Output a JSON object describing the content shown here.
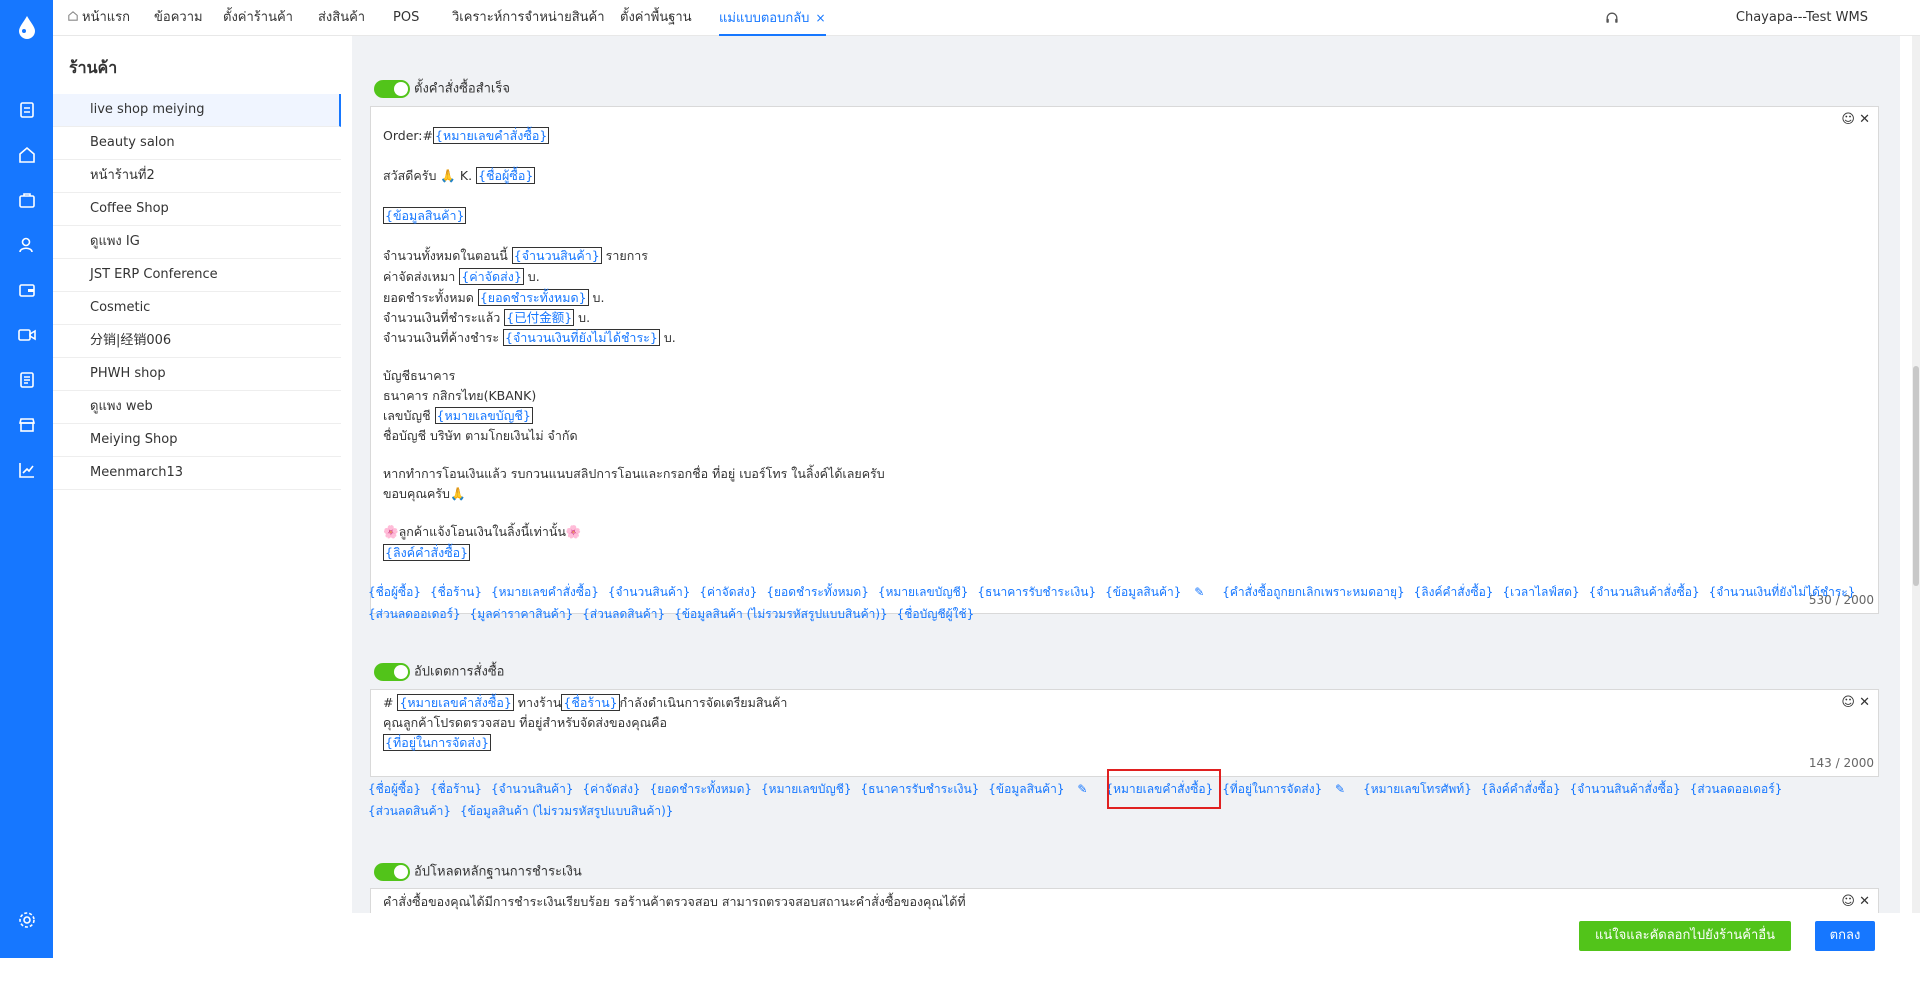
{
  "rail": {
    "icons": [
      "logo-icon",
      "document-icon",
      "home-icon",
      "bag-icon",
      "users-icon",
      "wallet-icon",
      "video-icon",
      "list-icon",
      "shop-icon",
      "chart-icon",
      "settings-icon"
    ]
  },
  "tabs": [
    {
      "label": "หน้าแรก"
    },
    {
      "label": "ข้อความ"
    },
    {
      "label": "ตั้งค่าร้านค้า"
    },
    {
      "label": "ส่งสินค้า"
    },
    {
      "label": "POS"
    },
    {
      "label": "วิเคราะห์การจำหน่ายสินค้า"
    },
    {
      "label": "ตั้งค่าพื้นฐาน"
    },
    {
      "label": "แม่แบบตอบกลับ",
      "close": "×"
    }
  ],
  "user": {
    "name": "Chayapa---Test WMS"
  },
  "store": {
    "title": "ร้านค้า",
    "items": [
      "live shop meiying",
      "Beauty salon",
      "หน้าร้านที่2",
      "Coffee Shop",
      "ดูแพง IG",
      "JST ERP Conference",
      "Cosmetic",
      "分销|经销006",
      "PHWH shop",
      "ดูแพง web",
      "Meiying Shop",
      "Meenmarch13"
    ]
  },
  "sections": {
    "s1": {
      "title": "ตั้งคำสั่งซื้อสำเร็จ",
      "counter": "530 / 2000",
      "lines": {
        "l1a": "Order:#",
        "l1t": "{หมายเลขคำสั่งซื้อ}",
        "l2a": "สวัสดีครับ 🙏 K.",
        "l2t": "{ชื่อผู้ซื้อ}",
        "l3t": "{ข้อมูลสินค้า}",
        "l4a": "จำนวนทั้งหมดในตอนนี้",
        "l4t": "{จำนวนสินค้า}",
        "l4b": "รายการ",
        "l5a": "ค่าจัดส่งเหมา",
        "l5t": "{ค่าจัดส่ง}",
        "l5b": "บ.",
        "l6a": "ยอดชำระทั้งหมด",
        "l6t": "{ยอดชำระทั้งหมด}",
        "l6b": "บ.",
        "l7a": "จำนวนเงินที่ชำระแล้ว",
        "l7t": "{已付金额}",
        "l7b": "บ.",
        "l8a": "จำนวนเงินที่ค้างชำระ",
        "l8t": "{จำนวนเงินที่ยังไม่ได้ชำระ}",
        "l8b": "บ.",
        "l9": "บัญชีธนาคาร",
        "l10": "ธนาคาร กสิกรไทย(KBANK)",
        "l11a": "เลขบัญชี",
        "l11t": "{หมายเลขบัญชี}",
        "l12": "ชื่อบัญชี บริษัท ตามโกยเงินไม่ จำกัด",
        "l13": "หากทำการโอนเงินแล้ว รบกวนแนบสลิปการโอนและกรอกชื่อ ที่อยู่ เบอร์โทร ในลิ้งค์ได้เลยครับ",
        "l14": "ขอบคุณครับ🙏",
        "l15": "🌸ลูกค้าแจ้งโอนเงินในลิ้งนี้เท่านั้น🌸",
        "l16t": "{ลิงค์คำสั่งซื้อ}"
      },
      "vars": [
        "{ชื่อผู้ซื้อ}",
        "{ชื่อร้าน}",
        "{หมายเลขคำสั่งซื้อ}",
        "{จำนวนสินค้า}",
        "{ค่าจัดส่ง}",
        "{ยอดชำระทั้งหมด}",
        "{หมายเลขบัญชี}",
        "{ธนาคารรับชำระเงิน}",
        "{ข้อมูลสินค้า}",
        "{คำสั่งซื้อถูกยกเลิกเพราะหมดอายุ}",
        "{ลิงค์คำสั่งซื้อ}",
        "{เวลาไลฟ์สด}",
        "{จำนวนสินค้าสั่งซื้อ}",
        "{จำนวนเงินที่ยังไม่ได้ชำระ}",
        "{ส่วนลดออเดอร์}",
        "{มูลค่าราคาสินค้า}",
        "{ส่วนลดสินค้า}",
        "{ข้อมูลสินค้า (ไม่รวมรหัสรูปแบบสินค้า)}",
        "{ชื่อบัญชีผู้ใช้}"
      ]
    },
    "s2": {
      "title": "อัปเดตการสั่งซื้อ",
      "counter": "143 / 2000",
      "lines": {
        "l1a": "#",
        "l1t": "{หมายเลขคำสั่งซื้อ}",
        "l1b": "ทางร้าน",
        "l1t2": "{ชื่อร้าน}",
        "l1c": "กำลังดำเนินการจัดเตรียมสินค้า",
        "l2": "คุณลูกค้าโปรดตรวจสอบ ที่อยู่สำหรับจัดส่งของคุณคือ",
        "l3t": "{ที่อยู่ในการจัดส่ง}"
      },
      "vars": [
        "{ชื่อผู้ซื้อ}",
        "{ชื่อร้าน}",
        "{จำนวนสินค้า}",
        "{ค่าจัดส่ง}",
        "{ยอดชำระทั้งหมด}",
        "{หมายเลขบัญชี}",
        "{ธนาคารรับชำระเงิน}",
        "{ข้อมูลสินค้า}",
        "{หมายเลขคำสั่งซื้อ}",
        "{ที่อยู่ในการจัดส่ง}",
        "{หมายเลขโทรศัพท์}",
        "{ลิงค์คำสั่งซื้อ}",
        "{จำนวนสินค้าสั่งซื้อ}",
        "{ส่วนลดออเดอร์}",
        "{ส่วนลดสินค้า}",
        "{ข้อมูลสินค้า (ไม่รวมรหัสรูปแบบสินค้า)}"
      ]
    },
    "s3": {
      "title": "อัปโหลดหลักฐานการชำระเงิน",
      "line": "คำสั่งซื้อของคุณได้มีการชำระเงินเรียบร้อย รอร้านค้าตรวจสอบ สามารถตรวจสอบสถานะคำสั่งซื้อของคุณได้ที่"
    }
  },
  "footer": {
    "copy_btn": "แน่ใจและคัดลอกไปยังร้านค้าอื่น ๆ",
    "ok_btn": "ตกลง"
  },
  "colors": {
    "accent": "#1677ff",
    "toggle": "#52c41a",
    "highlight": "#e02020"
  }
}
